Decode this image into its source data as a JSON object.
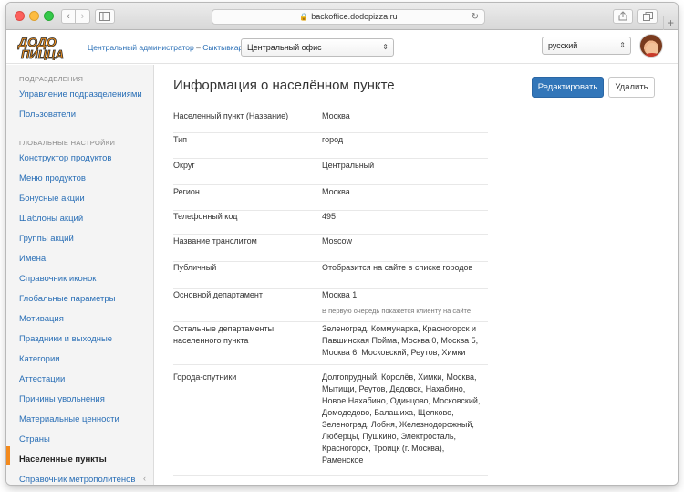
{
  "browser": {
    "url": "backoffice.dodopizza.ru"
  },
  "header": {
    "logo_text": "ДОДО ПИЦЦА",
    "admin_role": "Центральный администратор",
    "admin_separator": " – ",
    "admin_city": "Сыктывкар",
    "office_select": "Центральный офис",
    "language_select": "русский"
  },
  "sidebar": {
    "section1": "ПОДРАЗДЕЛЕНИЯ",
    "section1_items": [
      {
        "label": "Управление подразделениями"
      },
      {
        "label": "Пользователи"
      }
    ],
    "section2": "ГЛОБАЛЬНЫЕ НАСТРОЙКИ",
    "section2_items": [
      {
        "label": "Конструктор продуктов"
      },
      {
        "label": "Меню продуктов"
      },
      {
        "label": "Бонусные акции"
      },
      {
        "label": "Шаблоны акций"
      },
      {
        "label": "Группы акций"
      },
      {
        "label": "Имена"
      },
      {
        "label": "Справочник иконок"
      },
      {
        "label": "Глобальные параметры"
      },
      {
        "label": "Мотивация"
      },
      {
        "label": "Праздники и выходные"
      },
      {
        "label": "Категории"
      },
      {
        "label": "Аттестации"
      },
      {
        "label": "Причины увольнения"
      },
      {
        "label": "Материальные ценности"
      },
      {
        "label": "Страны"
      },
      {
        "label": "Населенные пункты"
      },
      {
        "label": "Справочник метрополитенов"
      }
    ],
    "active_item": "Населенные пункты"
  },
  "main": {
    "title": "Информация о населённом пункте",
    "edit_button": "Редактировать",
    "delete_button": "Удалить",
    "fields": [
      {
        "label": "Населенный пункт (Название)",
        "value": "Москва"
      },
      {
        "label": "Тип",
        "value": "город"
      },
      {
        "label": "Округ",
        "value": "Центральный"
      },
      {
        "label": "Регион",
        "value": "Москва"
      },
      {
        "label": "Телефонный код",
        "value": "495"
      },
      {
        "label": "Название транслитом",
        "value": "Moscow"
      },
      {
        "label": "Публичный",
        "value": "Отобразится на сайте в списке городов"
      },
      {
        "label": "Основной департамент",
        "value": "Москва 1",
        "hint": "В первую очередь покажется клиенту на сайте"
      },
      {
        "label": "Остальные департаменты населенного пункта",
        "value": "Зеленоград, Коммунарка, Красногорск и Павшинская Пойма, Москва 0, Москва 5, Москва 6, Московский, Реутов, Химки"
      },
      {
        "label": "Города-спутники",
        "value": "Долгопрудный, Королёв, Химки, Москва, Мытищи, Реутов, Дедовск, Нахабино, Новое Нахабино, Одинцово, Московский, Домодедово, Балашиха, Щелково, Зеленоград, Лобня, Железнодорожный, Люберцы, Пушкино, Электросталь, Красногорск, Троицк (г. Москва), Раменское"
      }
    ]
  },
  "colors": {
    "link": "#2a6fb6",
    "primary_button": "#3276b9",
    "active_marker": "#f38a1d",
    "logo_orange": "#f7941d"
  }
}
